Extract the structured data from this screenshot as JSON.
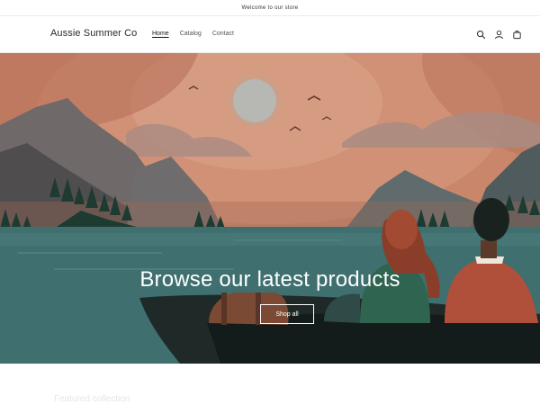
{
  "announcement": {
    "text": "Welcome to our store"
  },
  "header": {
    "logo": "Aussie Summer Co",
    "nav": [
      {
        "label": "Home",
        "active": true
      },
      {
        "label": "Catalog",
        "active": false
      },
      {
        "label": "Contact",
        "active": false
      }
    ],
    "icons": [
      "search-icon",
      "account-icon",
      "cart-icon"
    ]
  },
  "hero": {
    "heading": "Browse our latest products",
    "button_label": "Shop all"
  },
  "section_below": {
    "heading": "Featured collection"
  },
  "colors": {
    "sky": "#c9866a",
    "sun": "#b7b7b3",
    "lake": "#3f6f6f",
    "boat": "#1f2a28"
  }
}
